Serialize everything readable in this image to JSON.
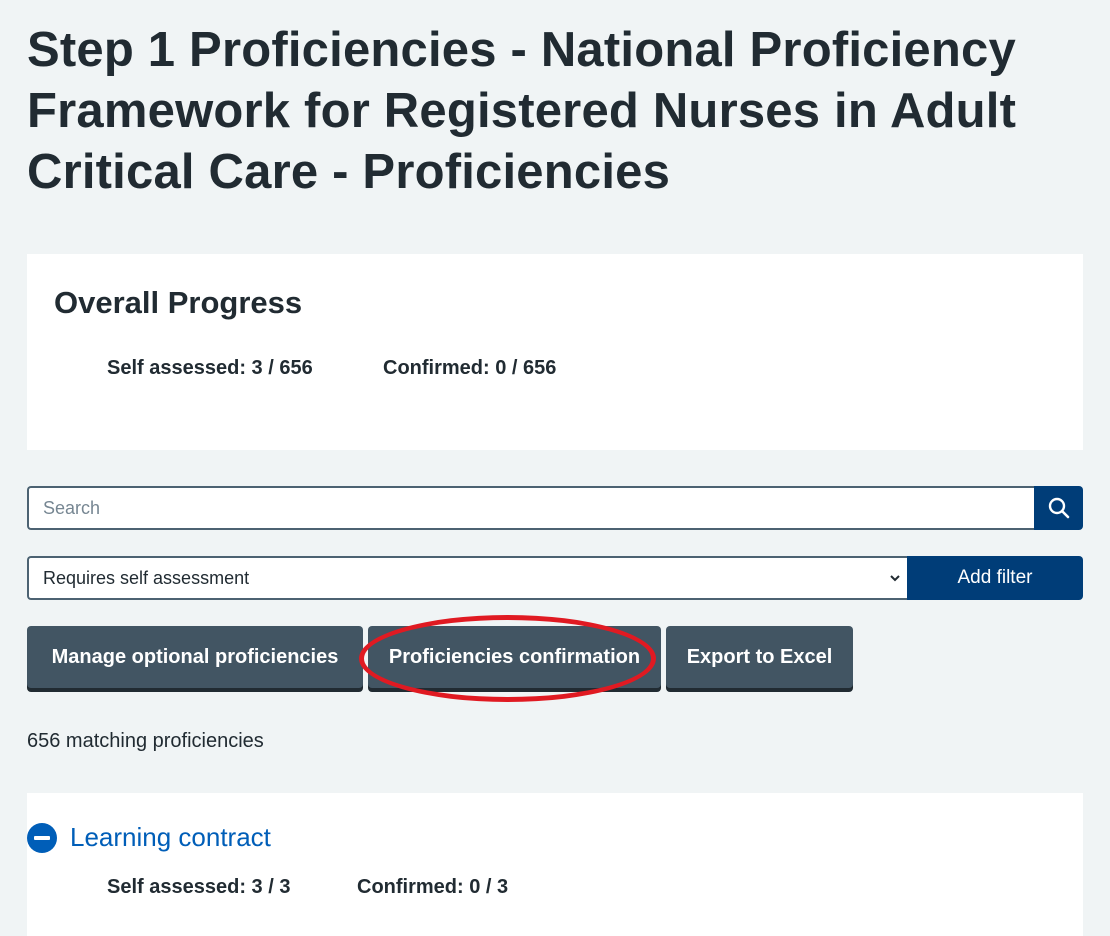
{
  "page": {
    "title": "Step 1 Proficiencies - National Proficiency Framework for Registered Nurses in Adult Critical Care - Proficiencies"
  },
  "overall": {
    "heading": "Overall Progress",
    "self_assessed": "Self assessed: 3 / 656",
    "confirmed": "Confirmed: 0 / 656"
  },
  "search": {
    "placeholder": "Search",
    "icon": "search-icon"
  },
  "filter": {
    "selected": "Requires self assessment",
    "add_label": "Add filter"
  },
  "actions": {
    "manage": "Manage optional proficiencies",
    "confirmation": "Proficiencies confirmation",
    "export": "Export to Excel"
  },
  "results": {
    "count_text": "656 matching proficiencies"
  },
  "section": {
    "title": "Learning contract",
    "icon": "minus-circle-icon",
    "self_assessed": "Self assessed: 3 / 3",
    "confirmed": "Confirmed: 0 / 3"
  },
  "colors": {
    "background": "#f0f4f5",
    "primary_blue": "#003d78",
    "link_blue": "#005eb8",
    "secondary_button": "#425563",
    "annotation_red": "#e01a22"
  }
}
